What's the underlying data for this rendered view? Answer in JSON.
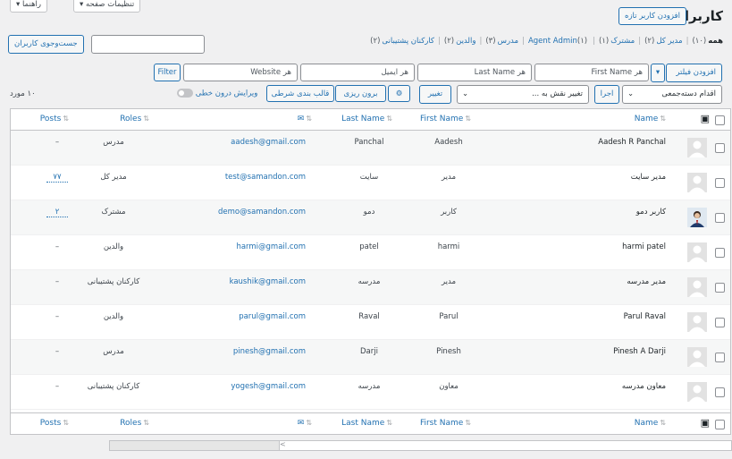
{
  "top": {
    "screen_options": "تنظیمات صفحه ▾",
    "help": "راهنما ▾"
  },
  "header": {
    "title": "کاربران",
    "add_new": "افزودن کاربر تازه"
  },
  "views": {
    "items": [
      {
        "label": "همه",
        "count": "(۱۰)",
        "current": true
      },
      {
        "label": "مدیر کل",
        "count": "(۲)"
      },
      {
        "label": "مشترک",
        "count": "(۱)"
      },
      {
        "label": "Agent Admin",
        "count": "(۱)"
      },
      {
        "label": "مدرس",
        "count": "(۳)"
      },
      {
        "label": "والدین",
        "count": "(۲)"
      },
      {
        "label": "کارکنان پشتیبانی",
        "count": "(۲)"
      }
    ],
    "separator": "|"
  },
  "search": {
    "placeholder": "",
    "button": "جست‌وجوی کاربران"
  },
  "filters": {
    "add_filter": "افزودن فیلتر",
    "add_filter_arrow": "▾",
    "first_name": "هر First Name",
    "last_name": "هر Last Name",
    "email": "هر ایمیل",
    "website": "هر Website",
    "filter_btn": "Filter"
  },
  "actions": {
    "bulk": "اقدام دسته‌جمعی",
    "apply": "اجرا",
    "change_role": "تغییر نقش به ...",
    "change": "تغییر",
    "gear": "⚙",
    "export": "برون ریزی",
    "conditional": "قالب بندی شرطی",
    "inline_edit": "ویرایش درون خطی",
    "items_count": "۱۰ مورد"
  },
  "columns": {
    "name": "Name",
    "first_name": "First Name",
    "last_name": "Last Name",
    "email_icon": "✉",
    "roles": "Roles",
    "posts": "Posts"
  },
  "rows": [
    {
      "name": "Aadesh R Panchal",
      "first": "Aadesh",
      "last": "Panchal",
      "email": "aadesh@gmail.com",
      "role": "مدرس",
      "posts": "–",
      "posts_link": false,
      "avatar": "default"
    },
    {
      "name": "مدیر سایت",
      "first": "مدیر",
      "last": "سایت",
      "email": "test@samandon.com",
      "role": "مدیر کل",
      "posts": "۷۷",
      "posts_link": true,
      "avatar": "default"
    },
    {
      "name": "کاربر دمو",
      "first": "کاربر",
      "last": "دمو",
      "email": "demo@samandon.com",
      "role": "مشترک",
      "posts": "۲",
      "posts_link": true,
      "avatar": "photo"
    },
    {
      "name": "harmi patel",
      "first": "harmi",
      "last": "patel",
      "email": "harmi@gmail.com",
      "role": "والدین",
      "posts": "–",
      "posts_link": false,
      "avatar": "default"
    },
    {
      "name": "مدیر مدرسه",
      "first": "مدیر",
      "last": "مدرسه",
      "email": "kaushik@gmail.com",
      "role": "کارکنان پشتیبانی",
      "posts": "–",
      "posts_link": false,
      "avatar": "default"
    },
    {
      "name": "Parul Raval",
      "first": "Parul",
      "last": "Raval",
      "email": "parul@gmail.com",
      "role": "والدین",
      "posts": "–",
      "posts_link": false,
      "avatar": "default"
    },
    {
      "name": "Pinesh A Darji",
      "first": "Pinesh",
      "last": "Darji",
      "email": "pinesh@gmail.com",
      "role": "مدرس",
      "posts": "–",
      "posts_link": false,
      "avatar": "default"
    },
    {
      "name": "معاون مدرسه",
      "first": "معاون",
      "last": "مدرسه",
      "email": "yogesh@gmail.com",
      "role": "کارکنان پشتیبانی",
      "posts": "–",
      "posts_link": false,
      "avatar": "default"
    }
  ],
  "scrollbar": {
    "arrow": ">"
  },
  "colors": {
    "accent": "#2271b1",
    "text": "#3c434a",
    "border": "#c3c4c7",
    "bg": "#f0f0f1"
  }
}
